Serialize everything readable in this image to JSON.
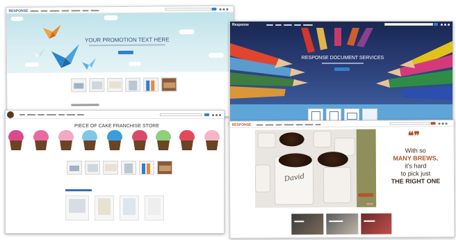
{
  "shot1": {
    "logo_text": "RESPONSE",
    "hero_title": "YOUR PROMOTION TEXT HERE",
    "colors": {
      "logo": "#2e5e9e",
      "title": "#3a5378",
      "button": "#2f7fd0"
    },
    "icons": [
      "origami-bird-orange-icon",
      "origami-bird-blue-icon",
      "origami-bird-white-icon"
    ]
  },
  "shot2": {
    "logo_text": "Response",
    "hero_title": "RESPONSE DOCUMENT SERVICES",
    "colors": {
      "band": "#5fa5d8",
      "button": "#2f7fd0"
    },
    "icons": [
      "colored-pencils-icon",
      "document-card-icon",
      "calendar-card-icon",
      "envelope-card-icon"
    ]
  },
  "shot3": {
    "hero_title": "PIECE OF CAKE FRANCHISE STORE",
    "colors": {
      "link": "#2f6fb8",
      "title": "#3a3a3a"
    },
    "icons": [
      "cupcake-icon"
    ]
  },
  "shot4": {
    "logo_text": "RESPONSE",
    "promo_lines": [
      "With so",
      "MANY BREWS,",
      "it's hard",
      "to pick just",
      "THE RIGHT ONE"
    ],
    "cup_name": "David",
    "colors": {
      "accent": "#b5532a",
      "olive": "#8e8f5a",
      "text": "#3b2a20"
    },
    "icons": [
      "coffee-cup-icon",
      "quote-mark-icon"
    ]
  }
}
